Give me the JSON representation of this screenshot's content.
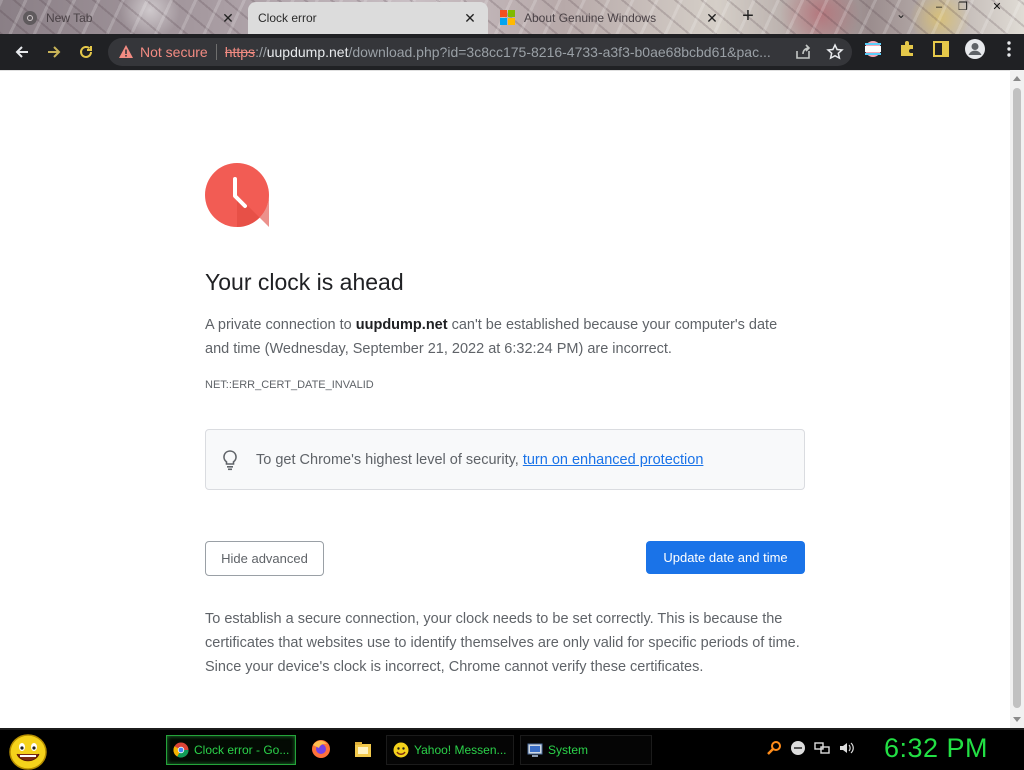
{
  "tabs": [
    {
      "title": "New Tab",
      "state": "inactive",
      "favicon": "chrome-icon"
    },
    {
      "title": "Clock error",
      "state": "active",
      "favicon": "none"
    },
    {
      "title": "About Genuine Windows",
      "state": "inactive",
      "favicon": "microsoft-icon"
    }
  ],
  "window_controls": {
    "minimize": "–",
    "restore": "❐",
    "close": "✕"
  },
  "omnibox": {
    "security_label": "Not secure",
    "url_scheme": "https",
    "url_sep": "://",
    "url_host": "uupdump.net",
    "url_rest": "/download.php?id=3c8cc175-8216-4733-a3f3-b0ae68bcbd61&pac..."
  },
  "page": {
    "heading": "Your clock is ahead",
    "para_prefix": "A private connection to ",
    "para_host": "uupdump.net",
    "para_suffix": " can't be established because your computer's date and time (Wednesday, September 21, 2022 at 6:32:24 PM) are incorrect.",
    "error_code": "NET::ERR_CERT_DATE_INVALID",
    "tip_text": "To get Chrome's highest level of security,",
    "tip_link": "turn on enhanced protection",
    "hide_advanced": "Hide advanced",
    "update_button": "Update date and time",
    "explanation": "To establish a secure connection, your clock needs to be set correctly. This is because the certificates that websites use to identify themselves are only valid for specific periods of time. Since your device's clock is incorrect, Chrome cannot verify these certificates."
  },
  "taskbar": {
    "items": [
      {
        "label": "Clock error - Go...",
        "icon": "chrome-icon",
        "active": true
      },
      {
        "label": "Yahoo! Messen...",
        "icon": "yahoo-messenger-icon",
        "active": false
      },
      {
        "label": "System",
        "icon": "system-icon",
        "active": false
      }
    ],
    "clock": "6:32 PM"
  },
  "colors": {
    "accent": "#1a73e8",
    "error_red": "#f25c54",
    "not_secure": "#f28b82",
    "taskbar_green": "#22e044"
  }
}
